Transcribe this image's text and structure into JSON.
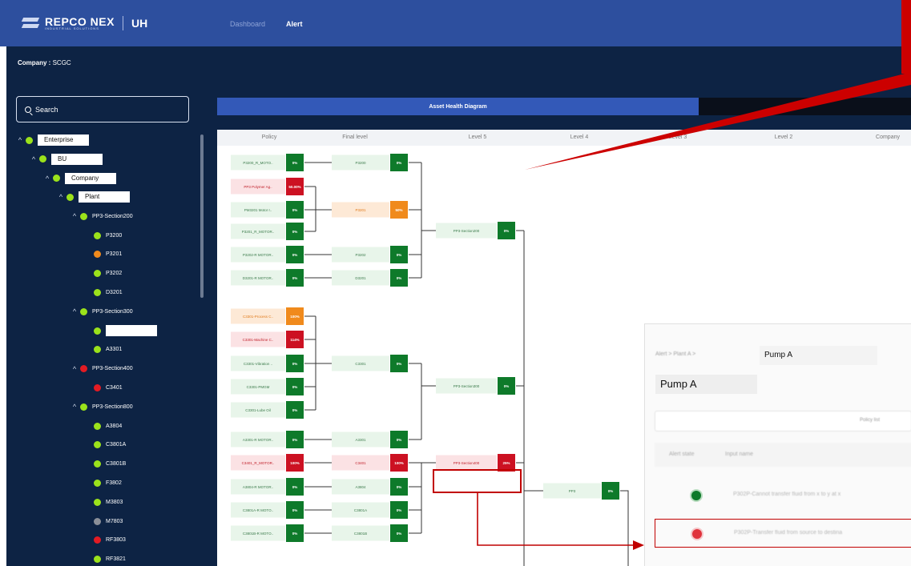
{
  "header": {
    "brand": "REPCO NEX",
    "brand_sub": "INDUSTRIAL SOLUTIONS",
    "partner": "UH",
    "nav": [
      {
        "label": "Dashboard",
        "active": false
      },
      {
        "label": "Alert",
        "active": true
      }
    ]
  },
  "sidebar": {
    "company_label": "Company :",
    "company_value": "SCGC",
    "search_placeholder": "Search",
    "tree": [
      {
        "label": "Enterprise",
        "level": 0,
        "status": "green",
        "expandable": true,
        "boxed": true
      },
      {
        "label": "BU",
        "level": 1,
        "status": "green",
        "expandable": true,
        "boxed": true
      },
      {
        "label": "Company",
        "level": 2,
        "status": "green",
        "expandable": true,
        "boxed": true
      },
      {
        "label": "Plant",
        "level": 3,
        "status": "green",
        "expandable": true,
        "boxed": true
      },
      {
        "label": "PP3-Section200",
        "level": 4,
        "status": "green",
        "expandable": true
      },
      {
        "label": "P3200",
        "level": 5,
        "status": "green"
      },
      {
        "label": "P3201",
        "level": 5,
        "status": "orange"
      },
      {
        "label": "P3202",
        "level": 5,
        "status": "green"
      },
      {
        "label": "D3201",
        "level": 5,
        "status": "green"
      },
      {
        "label": "PP3-Section300",
        "level": 4,
        "status": "green",
        "expandable": true
      },
      {
        "label": "",
        "level": 5,
        "status": "green",
        "boxed": true
      },
      {
        "label": "A3301",
        "level": 5,
        "status": "green"
      },
      {
        "label": "PP3-Section400",
        "level": 4,
        "status": "red",
        "expandable": true
      },
      {
        "label": "C3401",
        "level": 5,
        "status": "red"
      },
      {
        "label": "PP3-Section800",
        "level": 4,
        "status": "green",
        "expandable": true
      },
      {
        "label": "A3804",
        "level": 5,
        "status": "green"
      },
      {
        "label": "C3801A",
        "level": 5,
        "status": "green"
      },
      {
        "label": "C3801B",
        "level": 5,
        "status": "green"
      },
      {
        "label": "F3802",
        "level": 5,
        "status": "green"
      },
      {
        "label": "M3803",
        "level": 5,
        "status": "green"
      },
      {
        "label": "M7803",
        "level": 5,
        "status": "gray"
      },
      {
        "label": "RF3803",
        "level": 5,
        "status": "red"
      },
      {
        "label": "RF3821",
        "level": 5,
        "status": "green"
      }
    ]
  },
  "main": {
    "tab_label": "Asset Health Diagram",
    "columns": [
      "Policy",
      "Final level",
      "Level 5",
      "Level 4",
      "Level 3",
      "Level 2",
      "Company"
    ],
    "policies": [
      {
        "name": "P3200_R_MOTO..",
        "pct": "0%",
        "status": "green"
      },
      {
        "name": "PP3 Polymer Ag..",
        "pct": "50.00%",
        "status": "red"
      },
      {
        "name": "PM3201 Motor r..",
        "pct": "0%",
        "status": "green"
      },
      {
        "name": "P3201_R_MOTOR..",
        "pct": "0%",
        "status": "green"
      },
      {
        "name": "P3202-R MOTOR..",
        "pct": "0%",
        "status": "green"
      },
      {
        "name": "D3201-R MOTOR..",
        "pct": "0%",
        "status": "green"
      },
      {
        "name": "C3301-Process C..",
        "pct": "100%",
        "status": "orange"
      },
      {
        "name": "C3301-Machine C..",
        "pct": "114%",
        "status": "red"
      },
      {
        "name": "C3301-Vibration ..",
        "pct": "0%",
        "status": "green"
      },
      {
        "name": "C3301-PMGM",
        "pct": "0%",
        "status": "green"
      },
      {
        "name": "C3301-Lube Oil",
        "pct": "0%",
        "status": "green"
      },
      {
        "name": "A3301-R MOTOR..",
        "pct": "0%",
        "status": "green"
      },
      {
        "name": "C3401_R_MOTOR..",
        "pct": "100%",
        "status": "red"
      },
      {
        "name": "A3804-R MOTOR..",
        "pct": "0%",
        "status": "green"
      },
      {
        "name": "C3801A-R MOTO..",
        "pct": "0%",
        "status": "green"
      },
      {
        "name": "C3801B-R MOTO..",
        "pct": "0%",
        "status": "green"
      }
    ],
    "finals": [
      {
        "name": "P3200",
        "pct": "0%",
        "status": "green"
      },
      {
        "name": "P3201",
        "pct": "50%",
        "status": "orange"
      },
      {
        "name": "P3202",
        "pct": "0%",
        "status": "green"
      },
      {
        "name": "D3201",
        "pct": "0%",
        "status": "green"
      },
      {
        "name": "C3301",
        "pct": "0%",
        "status": "green"
      },
      {
        "name": "A3301",
        "pct": "0%",
        "status": "green"
      },
      {
        "name": "C3401",
        "pct": "100%",
        "status": "red"
      },
      {
        "name": "A3804",
        "pct": "0%",
        "status": "green"
      },
      {
        "name": "C3801A",
        "pct": "0%",
        "status": "green"
      },
      {
        "name": "C3801B",
        "pct": "0%",
        "status": "green"
      }
    ],
    "level5": [
      {
        "name": "PP3-Section200",
        "pct": "0%",
        "status": "green"
      },
      {
        "name": "PP3-Section300",
        "pct": "0%",
        "status": "green"
      },
      {
        "name": "PP3-Section400",
        "pct": "25%",
        "status": "red",
        "highlight": true
      }
    ],
    "level4": [
      {
        "name": "PP3",
        "pct": "0%",
        "status": "green"
      }
    ]
  },
  "popup": {
    "breadcrumb": "Alert > Plant A >",
    "breadcrumb_field": "Pump A",
    "title": "Pump A",
    "filter_label": "Policy list",
    "table_headers": [
      "Alert state",
      "Input name"
    ],
    "rows": [
      {
        "status": "green",
        "text": "P302P-Cannot transfer fluid from x to y at x"
      },
      {
        "status": "red",
        "text": "P302P-Transfer fluid from source to destina",
        "highlight": true
      }
    ]
  },
  "colors": {
    "green": "#0e7a2a",
    "orange": "#f08a1c",
    "red": "#cc1122",
    "gray": "#8a8f98",
    "lime": "#9be21b",
    "header_bg": "#2d4f9e",
    "panel_bg": "#0d2344",
    "annotation_red": "#c10000"
  }
}
